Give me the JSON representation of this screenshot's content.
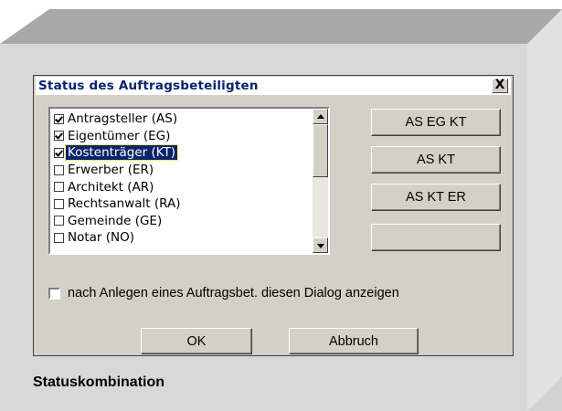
{
  "dialog": {
    "title": "Status des Auftragsbeteiligten",
    "close_label": "X"
  },
  "list": {
    "items": [
      {
        "label": "Antragsteller (AS)",
        "checked": true
      },
      {
        "label": "Eigentümer (EG)",
        "checked": true
      },
      {
        "label": "Kostenträger (KT)",
        "checked": true,
        "selected": true
      },
      {
        "label": "Erwerber (ER)",
        "checked": false
      },
      {
        "label": "Architekt (AR)",
        "checked": false
      },
      {
        "label": "Rechtsanwalt (RA)",
        "checked": false
      },
      {
        "label": "Gemeinde (GE)",
        "checked": false
      },
      {
        "label": "Notar (NO)",
        "checked": false
      }
    ]
  },
  "combos": {
    "b1": "AS EG KT",
    "b2": "AS KT",
    "b3": "AS KT ER",
    "b4": ""
  },
  "option": {
    "label": "nach Anlegen eines Auftragsbet. diesen Dialog anzeigen",
    "checked": false
  },
  "buttons": {
    "ok": "OK",
    "cancel": "Abbruch"
  },
  "caption": "Statuskombination",
  "colors": {
    "selection": "#0a246a",
    "dialog_bg": "#d4d0c8"
  }
}
